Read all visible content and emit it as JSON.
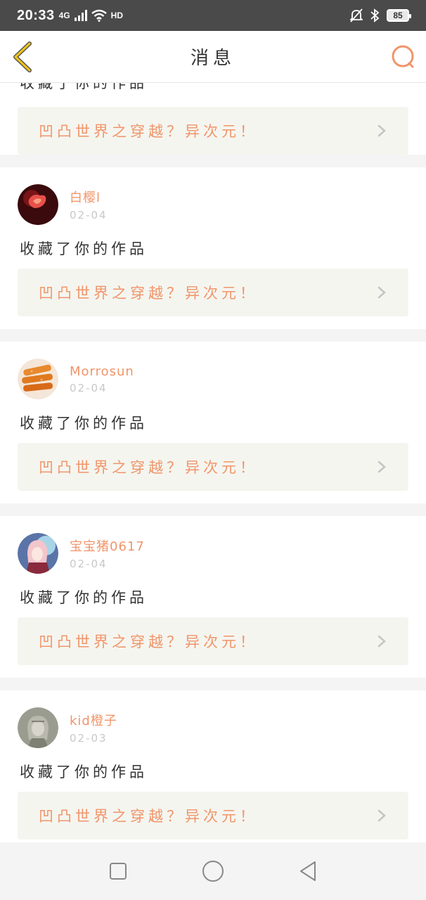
{
  "status_bar": {
    "time": "20:33",
    "network": "4G",
    "hd": "HD",
    "battery": "85"
  },
  "header": {
    "title": "消息",
    "back_icon": "chevron-left-icon",
    "search_icon": "search-icon"
  },
  "partial_item": {
    "action": "收藏了你的作品",
    "work_title": "凹凸世界之穿越？异次元！"
  },
  "items": [
    {
      "username": "白樱l",
      "date": "02-04",
      "action": "收藏了你的作品",
      "work_title": "凹凸世界之穿越？异次元！"
    },
    {
      "username": "Morrosun",
      "date": "02-04",
      "action": "收藏了你的作品",
      "work_title": "凹凸世界之穿越？异次元！"
    },
    {
      "username": "宝宝猪0617",
      "date": "02-04",
      "action": "收藏了你的作品",
      "work_title": "凹凸世界之穿越？异次元！"
    },
    {
      "username": "kid橙子",
      "date": "02-03",
      "action": "收藏了你的作品",
      "work_title": "凹凸世界之穿越？异次元！"
    }
  ],
  "colors": {
    "accent": "#f0956a",
    "back_arrow": "#f0c419"
  },
  "nav": {
    "recent": "square-icon",
    "home": "circle-icon",
    "back": "triangle-back-icon"
  }
}
